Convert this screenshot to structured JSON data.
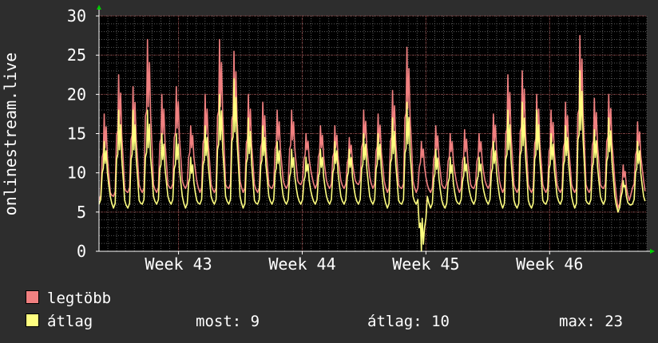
{
  "chart_data": {
    "type": "line",
    "title": "",
    "ylabel": "onlinestream.live",
    "ylim": [
      0,
      30
    ],
    "yticks": [
      0,
      5,
      10,
      15,
      20,
      25,
      30
    ],
    "xlim": [
      0,
      31
    ],
    "xticks": [
      {
        "x": 4.5,
        "label": "Week 43"
      },
      {
        "x": 11.5,
        "label": "Week 44"
      },
      {
        "x": 18.5,
        "label": "Week 45"
      },
      {
        "x": 25.5,
        "label": "Week 46"
      }
    ],
    "grid": true,
    "series": [
      {
        "name": "legtöbb",
        "color": "#f08080",
        "peaks": [
          17.5,
          22.5,
          21,
          27,
          20,
          21,
          16,
          20,
          27,
          25.5,
          20,
          19,
          18,
          18,
          15,
          16,
          16,
          14.5,
          18,
          17.5,
          20.5,
          26,
          14,
          16,
          15,
          15.5,
          15,
          17.5,
          22.5,
          23,
          20,
          18,
          19,
          27.5,
          19.5,
          20,
          11,
          16.5
        ],
        "troughs": [
          6.5,
          7,
          7.5,
          7.5,
          7.5,
          8,
          8,
          7.5,
          7.5,
          8,
          7.5,
          7.5,
          8,
          8,
          8.5,
          8,
          8,
          8,
          8.5,
          8,
          7.5,
          8,
          7.5,
          7.5,
          8,
          7.5,
          8,
          8,
          7.5,
          7.5,
          7.5,
          7.5,
          7.5,
          7.5,
          7.5,
          8,
          5.5,
          8
        ]
      },
      {
        "name": "átlag",
        "color": "#ffff80",
        "peaks": [
          14,
          18,
          18,
          18,
          15,
          15,
          12,
          16,
          20,
          22,
          17,
          16,
          14,
          13,
          12,
          13,
          14,
          13,
          15,
          15,
          17,
          19,
          0,
          13,
          12,
          12,
          12,
          14,
          18,
          19,
          18,
          15,
          16,
          23,
          15.5,
          17,
          9,
          14
        ],
        "troughs": [
          6,
          5.5,
          5.5,
          6,
          6,
          6,
          5.5,
          6,
          6,
          6,
          5.5,
          6,
          6,
          6,
          6,
          6,
          6,
          6,
          6,
          6,
          5.5,
          6,
          6,
          5.5,
          5.5,
          6,
          6,
          6,
          5.5,
          5.5,
          5.5,
          6,
          6,
          5.5,
          6,
          6,
          5,
          6
        ]
      }
    ]
  },
  "legend": {
    "max_label": "legtöbb",
    "avg_label": "átlag",
    "now_stat": "most: 9",
    "avg_stat": "átlag: 10",
    "max_stat": "max: 23"
  },
  "colors": {
    "background": "#2d2d2d",
    "plot_background": "#000000",
    "text": "#ffffff",
    "grid_major": "#8a3a3a",
    "grid_minor": "#5a5a5a",
    "axis_arrow": "#00cc00"
  }
}
